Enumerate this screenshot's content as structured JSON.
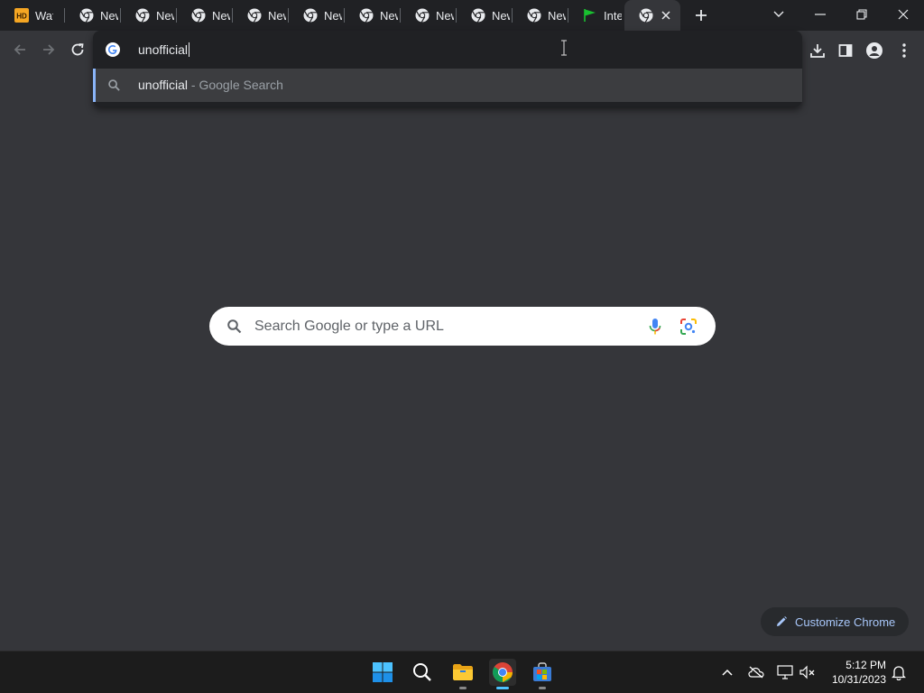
{
  "browser": {
    "tabs": [
      {
        "title": "Wat",
        "favicon": "hd-icon"
      },
      {
        "title": "New",
        "favicon": "chrome-icon"
      },
      {
        "title": "New",
        "favicon": "chrome-icon"
      },
      {
        "title": "New",
        "favicon": "chrome-icon"
      },
      {
        "title": "New",
        "favicon": "chrome-icon"
      },
      {
        "title": "New",
        "favicon": "chrome-icon"
      },
      {
        "title": "New",
        "favicon": "chrome-icon"
      },
      {
        "title": "New",
        "favicon": "chrome-icon"
      },
      {
        "title": "New",
        "favicon": "chrome-icon"
      },
      {
        "title": "New",
        "favicon": "chrome-icon"
      },
      {
        "title": "Inte",
        "favicon": "green-flag-icon"
      },
      {
        "title": "",
        "favicon": "chrome-icon",
        "active": true
      }
    ]
  },
  "omnibox": {
    "query": "unofficial",
    "suggestion_query": "unofficial",
    "suggestion_detail": " - Google Search"
  },
  "ntp": {
    "search_placeholder": "Search Google or type a URL",
    "customize_label": "Customize Chrome"
  },
  "taskbar": {
    "time": "5:12 PM",
    "date": "10/31/2023"
  },
  "colors": {
    "accent": "#8ab4f8",
    "background": "#35363a",
    "tabstrip": "#202124"
  }
}
